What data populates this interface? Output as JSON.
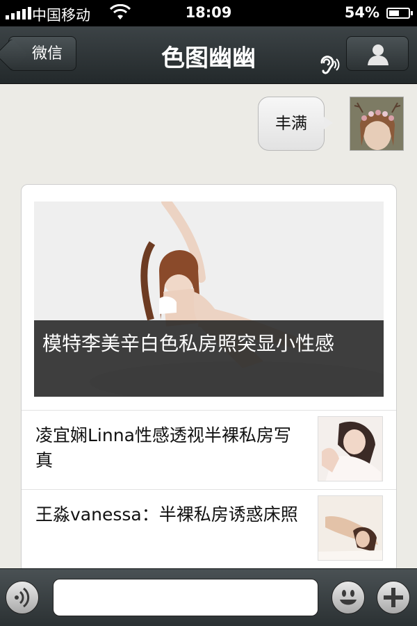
{
  "status_bar": {
    "carrier": "中国移动",
    "time": "18:09",
    "battery_percent": "54%",
    "battery_level": 0.54,
    "icons": [
      "signal-icon",
      "wifi-icon",
      "battery-icon"
    ]
  },
  "navbar": {
    "back_label": "微信",
    "title": "色图幽幽",
    "icons": [
      "ear-icon",
      "contact-icon"
    ]
  },
  "chat": {
    "sent_message": {
      "text": "丰满"
    },
    "news_card": {
      "cover_title": "模特李美辛白色私房照突显小性感",
      "items": [
        {
          "title": "凌宜娴Linna性感透视半裸私房写真"
        },
        {
          "title": "王淼vanessa：半裸私房诱惑床照"
        }
      ]
    }
  },
  "input_bar": {
    "text_value": "",
    "icons": [
      "voice-icon",
      "emoji-icon",
      "plus-icon"
    ]
  },
  "colors": {
    "navbar_top": "#3c4346",
    "navbar_bottom": "#23292b",
    "chat_background": "#ecebe6",
    "caption_overlay": "#1e1e1e"
  }
}
